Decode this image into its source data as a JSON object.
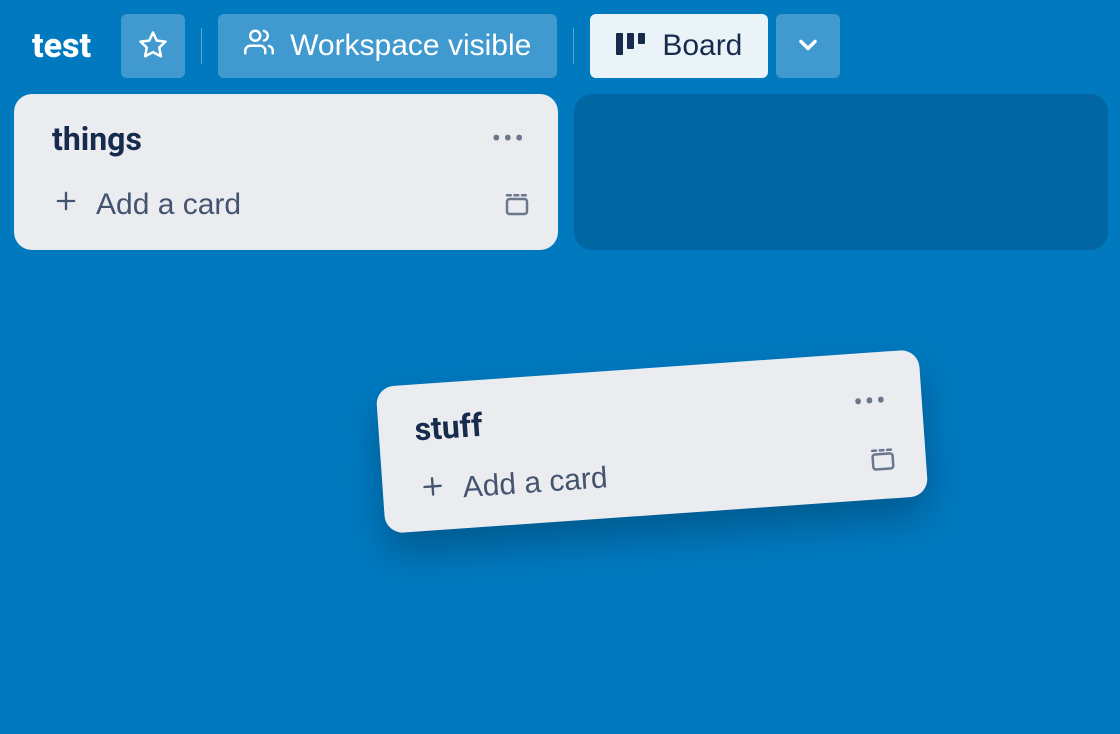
{
  "header": {
    "board_title": "test",
    "visibility_label": "Workspace visible",
    "view_label": "Board"
  },
  "lists": {
    "things": {
      "title": "things",
      "add_card_label": "Add a card"
    },
    "stuff": {
      "title": "stuff",
      "add_card_label": "Add a card"
    }
  }
}
